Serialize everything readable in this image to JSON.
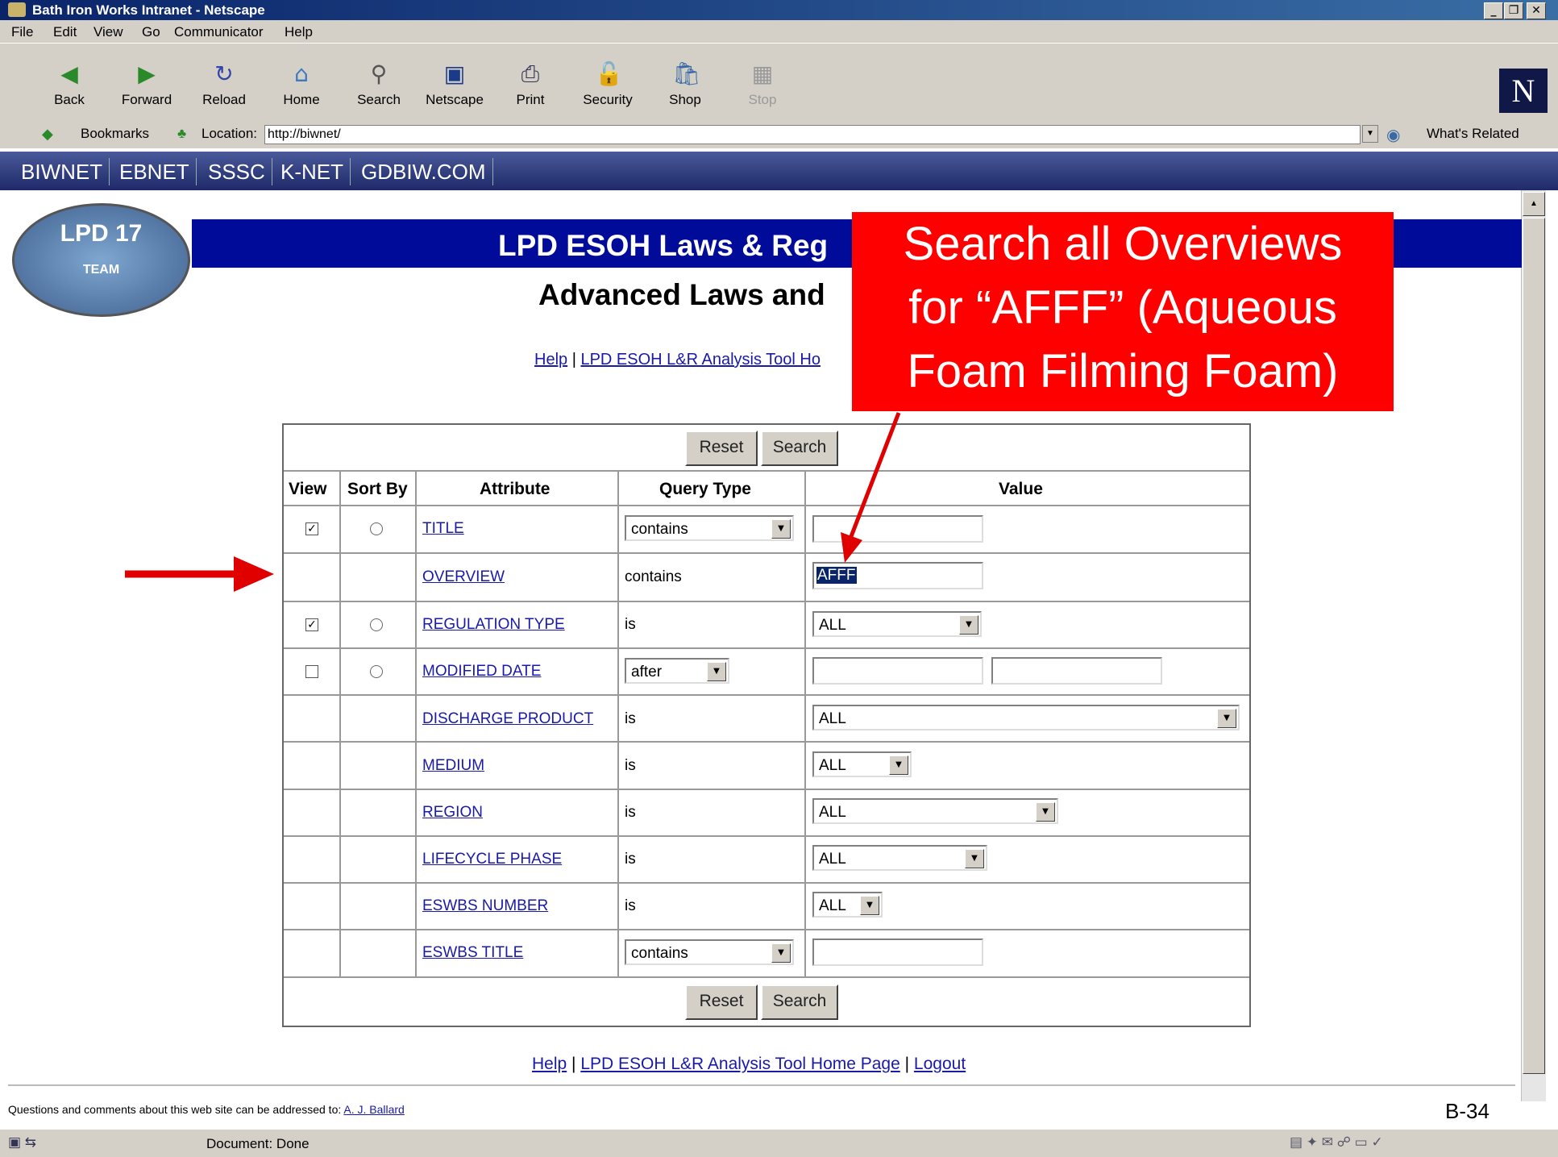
{
  "window": {
    "title": "Bath Iron Works Intranet - Netscape"
  },
  "menu": [
    "File",
    "Edit",
    "View",
    "Go",
    "Communicator",
    "Help"
  ],
  "toolbar": {
    "buttons": [
      {
        "label": "Back",
        "icon": "back-arrow-icon"
      },
      {
        "label": "Forward",
        "icon": "forward-arrow-icon"
      },
      {
        "label": "Reload",
        "icon": "reload-icon"
      },
      {
        "label": "Home",
        "icon": "home-icon"
      },
      {
        "label": "Search",
        "icon": "search-icon"
      },
      {
        "label": "Netscape",
        "icon": "netscape-icon"
      },
      {
        "label": "Print",
        "icon": "print-icon"
      },
      {
        "label": "Security",
        "icon": "lock-icon"
      },
      {
        "label": "Shop",
        "icon": "shop-icon"
      },
      {
        "label": "Stop",
        "icon": "stop-icon"
      }
    ],
    "brand_logo": "N"
  },
  "location_bar": {
    "bookmarks_label": "Bookmarks",
    "location_label": "Location:",
    "url": "http://biwnet/",
    "whats_related": "What's Related"
  },
  "site_nav": [
    "BIWNET",
    "EBNET",
    "SSSC",
    "K-NET",
    "GDBIW.COM"
  ],
  "page": {
    "logo_text": "LPD 17",
    "logo_sub": "TEAM",
    "title": "LPD ESOH Laws & Reg",
    "subtitle": "Advanced Laws and",
    "top_links": {
      "help": "Help",
      "sep": " | ",
      "home": "LPD ESOH L&R Analysis Tool Ho"
    },
    "bottom_links": {
      "help": "Help",
      "sep1": " | ",
      "home": "LPD ESOH L&R Analysis Tool Home Page",
      "sep2": " | ",
      "logout": "Logout"
    }
  },
  "form": {
    "reset_label": "Reset",
    "search_label": "Search",
    "headers": {
      "view": "View",
      "sort_by": "Sort By",
      "attribute": "Attribute",
      "query_type": "Query Type",
      "value": "Value"
    },
    "rows": [
      {
        "attribute": "TITLE",
        "query": "contains",
        "view": true,
        "sort": true
      },
      {
        "attribute": "OVERVIEW",
        "query": "contains",
        "value": "AFFF"
      },
      {
        "attribute": "REGULATION TYPE",
        "query": "is",
        "value": "ALL",
        "view": true,
        "sort": true
      },
      {
        "attribute": "MODIFIED DATE",
        "query": "after",
        "view": false,
        "sort": true
      },
      {
        "attribute": "DISCHARGE PRODUCT",
        "query": "is",
        "value": "ALL"
      },
      {
        "attribute": "MEDIUM",
        "query": "is",
        "value": "ALL"
      },
      {
        "attribute": "REGION",
        "query": "is",
        "value": "ALL"
      },
      {
        "attribute": "LIFECYCLE PHASE",
        "query": "is",
        "value": "ALL"
      },
      {
        "attribute": "ESWBS NUMBER",
        "query": "is",
        "value": "ALL"
      },
      {
        "attribute": "ESWBS TITLE",
        "query": "contains"
      }
    ]
  },
  "callout": {
    "lines": [
      "Search all Overviews",
      "for “AFFF” (Aqueous",
      "Foam Filming Foam)"
    ],
    "color": "#ff0000"
  },
  "footer": {
    "text": "Questions and comments about this web site can be addressed to: ",
    "contact": "A. J. Ballard",
    "page_label": "B-34"
  },
  "status": {
    "text": "Document: Done"
  }
}
